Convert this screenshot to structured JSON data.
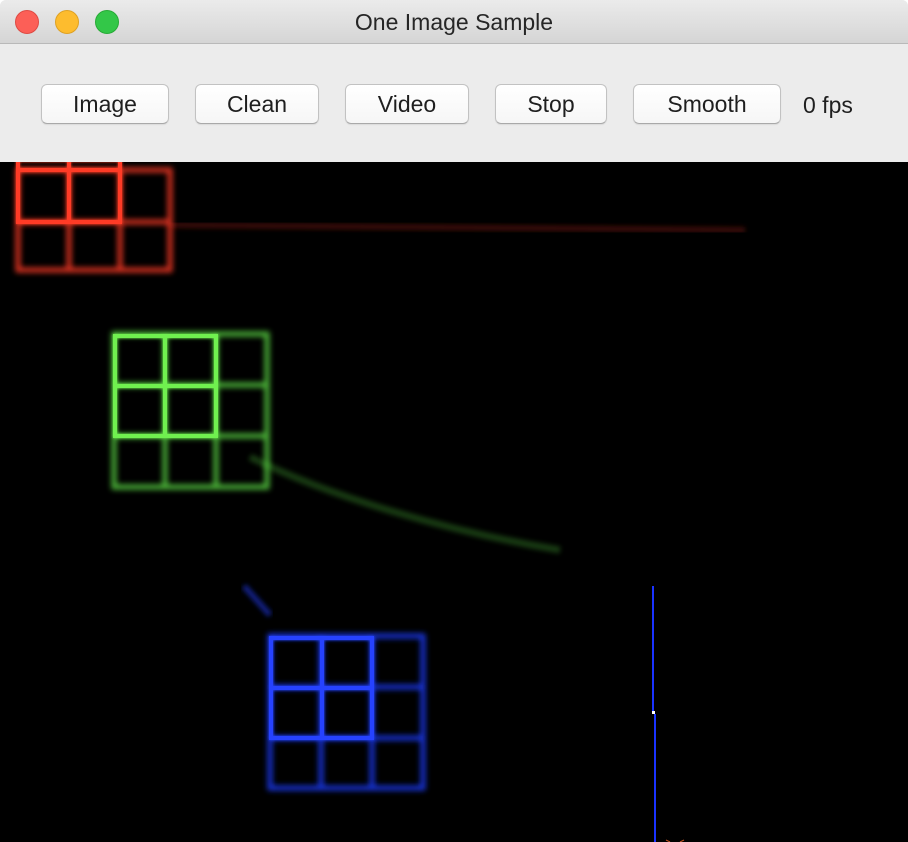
{
  "window": {
    "title": "One Image Sample"
  },
  "toolbar": {
    "image_label": "Image",
    "clean_label": "Clean",
    "video_label": "Video",
    "stop_label": "Stop",
    "smooth_label": "Smooth",
    "fps_text": "0 fps"
  },
  "canvas": {
    "background": "#000000",
    "grid_colors": {
      "red": "#ff3a28",
      "green": "#5fe346",
      "blue": "#1f3dff"
    },
    "line_color": "#1a33ff"
  },
  "colors": {
    "close": "#fc5f57",
    "minimize": "#fdbc2e",
    "zoom": "#33c748",
    "toolbar_bg": "#ececec"
  }
}
